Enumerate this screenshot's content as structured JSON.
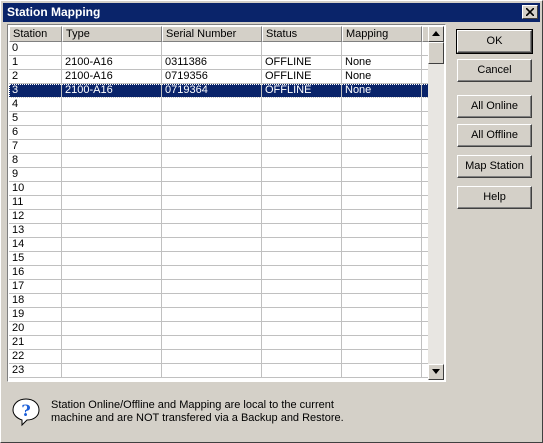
{
  "window": {
    "title": "Station Mapping"
  },
  "grid": {
    "columns": [
      "Station",
      "Type",
      "Serial Number",
      "Status",
      "Mapping"
    ],
    "rows": [
      [
        "0",
        "",
        "",
        "",
        ""
      ],
      [
        "1",
        "2100-A16",
        "0311386",
        "OFFLINE",
        "None"
      ],
      [
        "2",
        "2100-A16",
        "0719356",
        "OFFLINE",
        "None"
      ],
      [
        "3",
        "2100-A16",
        "0719364",
        "OFFLINE",
        "None"
      ],
      [
        "4",
        "",
        "",
        "",
        ""
      ],
      [
        "5",
        "",
        "",
        "",
        ""
      ],
      [
        "6",
        "",
        "",
        "",
        ""
      ],
      [
        "7",
        "",
        "",
        "",
        ""
      ],
      [
        "8",
        "",
        "",
        "",
        ""
      ],
      [
        "9",
        "",
        "",
        "",
        ""
      ],
      [
        "10",
        "",
        "",
        "",
        ""
      ],
      [
        "11",
        "",
        "",
        "",
        ""
      ],
      [
        "12",
        "",
        "",
        "",
        ""
      ],
      [
        "13",
        "",
        "",
        "",
        ""
      ],
      [
        "14",
        "",
        "",
        "",
        ""
      ],
      [
        "15",
        "",
        "",
        "",
        ""
      ],
      [
        "16",
        "",
        "",
        "",
        ""
      ],
      [
        "17",
        "",
        "",
        "",
        ""
      ],
      [
        "18",
        "",
        "",
        "",
        ""
      ],
      [
        "19",
        "",
        "",
        "",
        ""
      ],
      [
        "20",
        "",
        "",
        "",
        ""
      ],
      [
        "21",
        "",
        "",
        "",
        ""
      ],
      [
        "22",
        "",
        "",
        "",
        ""
      ],
      [
        "23",
        "",
        "",
        "",
        ""
      ]
    ],
    "selected_row": 3
  },
  "buttons": {
    "ok": "OK",
    "cancel": "Cancel",
    "all_online": "All Online",
    "all_offline": "All Offline",
    "map_station": "Map Station",
    "help": "Help"
  },
  "info": {
    "line1": "Station  Online/Offline and Mapping are local to the current",
    "line2": "machine and are NOT transfered via a Backup and Restore."
  },
  "colors": {
    "selection": "#0a246a",
    "dialog_bg": "#d4d0c8",
    "icon_blue": "#1c5fd8"
  }
}
